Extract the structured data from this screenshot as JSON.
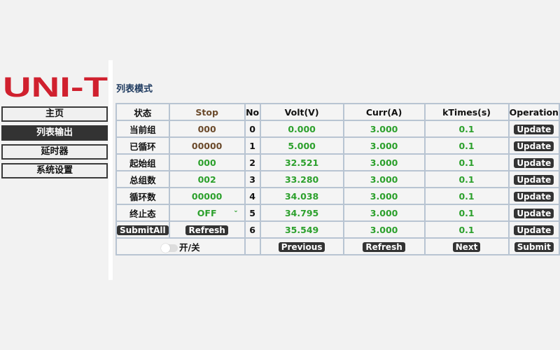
{
  "brand": {
    "logo_text": "UNI-T",
    "logo_color": "#d0202e"
  },
  "sidebar": {
    "items": [
      {
        "label": "主页",
        "active": false
      },
      {
        "label": "列表输出",
        "active": true
      },
      {
        "label": "延时器",
        "active": false
      },
      {
        "label": "系统设置",
        "active": false
      }
    ]
  },
  "page": {
    "title": "列表模式"
  },
  "table": {
    "headers": [
      "状态",
      "Stop",
      "No",
      "Volt(V)",
      "Curr(A)",
      "kTimes(s)",
      "Operation"
    ],
    "status_rows": [
      {
        "label": "当前组",
        "value": "000"
      },
      {
        "label": "已循环",
        "value": "00000"
      },
      {
        "label": "起始组",
        "value": "000"
      },
      {
        "label": "总组数",
        "value": "002"
      },
      {
        "label": "循环数",
        "value": "00000"
      },
      {
        "label": "终止态",
        "value": "OFF"
      }
    ],
    "rows": [
      {
        "no": "0",
        "volt": "0.000",
        "curr": "3.000",
        "ktimes": "0.1",
        "op": "Update"
      },
      {
        "no": "1",
        "volt": "5.000",
        "curr": "3.000",
        "ktimes": "0.1",
        "op": "Update"
      },
      {
        "no": "2",
        "volt": "32.521",
        "curr": "3.000",
        "ktimes": "0.1",
        "op": "Update"
      },
      {
        "no": "3",
        "volt": "33.280",
        "curr": "3.000",
        "ktimes": "0.1",
        "op": "Update"
      },
      {
        "no": "4",
        "volt": "34.038",
        "curr": "3.000",
        "ktimes": "0.1",
        "op": "Update"
      },
      {
        "no": "5",
        "volt": "34.795",
        "curr": "3.000",
        "ktimes": "0.1",
        "op": "Update"
      },
      {
        "no": "6",
        "volt": "35.549",
        "curr": "3.000",
        "ktimes": "0.1",
        "op": "Update"
      }
    ],
    "submit_all_label": "SubmitAll",
    "refresh_left_label": "Refresh",
    "toggle_label": "开/关",
    "toggle_on": false,
    "previous_label": "Previous",
    "refresh_label": "Refresh",
    "next_label": "Next",
    "submit_label": "Submit"
  },
  "colors": {
    "value_green": "#2ca02c",
    "value_brown": "#6b4a2b",
    "title_navy": "#1e3a5f"
  }
}
